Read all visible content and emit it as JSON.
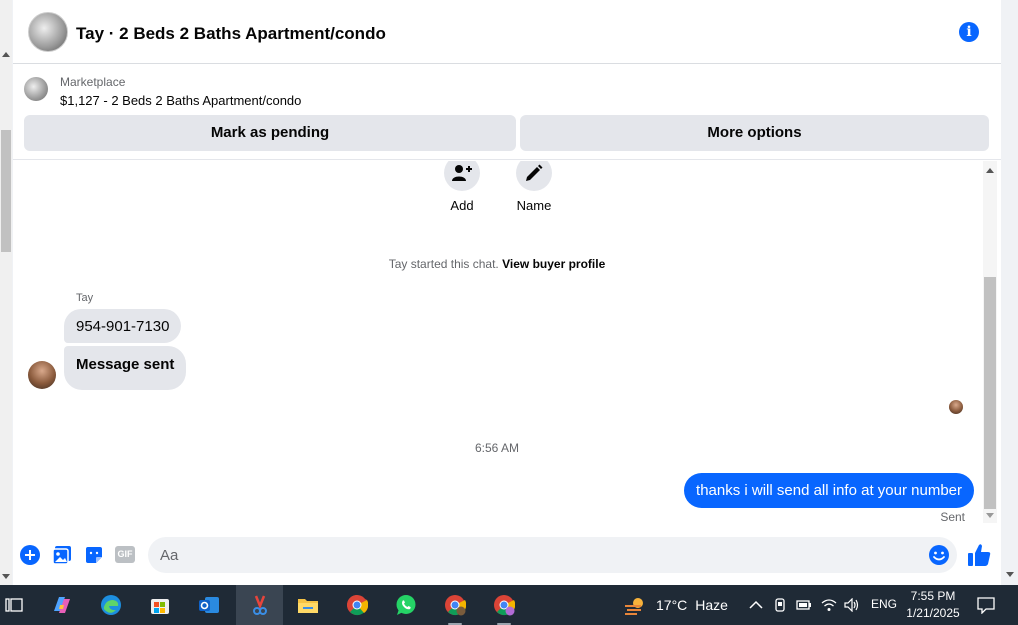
{
  "header": {
    "title": "Tay · 2 Beds 2 Baths Apartment/condo",
    "info_icon": "info-icon"
  },
  "marketplace": {
    "source": "Marketplace",
    "listing": "$1,127 - 2 Beds 2 Baths Apartment/condo",
    "buttons": {
      "pending": "Mark as pending",
      "more": "More options"
    }
  },
  "actions": {
    "add": "Add",
    "name": "Name"
  },
  "conversation": {
    "started_text": "Tay started this chat.",
    "view_profile": "View buyer profile",
    "sender": "Tay",
    "incoming": [
      "954-901-7130",
      "Message sent"
    ],
    "timestamp": "6:56 AM",
    "outgoing": "thanks i will send all info at your number",
    "status": "Sent"
  },
  "composer": {
    "placeholder": "Aa",
    "gif": "GIF"
  },
  "taskbar": {
    "temperature": "17°C",
    "condition": "Haze",
    "language": "ENG",
    "time": "7:55 PM",
    "date": "1/21/2025"
  },
  "colors": {
    "accent": "#0866ff",
    "bubble_in": "#e4e6eb",
    "taskbar": "#1f2a36"
  }
}
